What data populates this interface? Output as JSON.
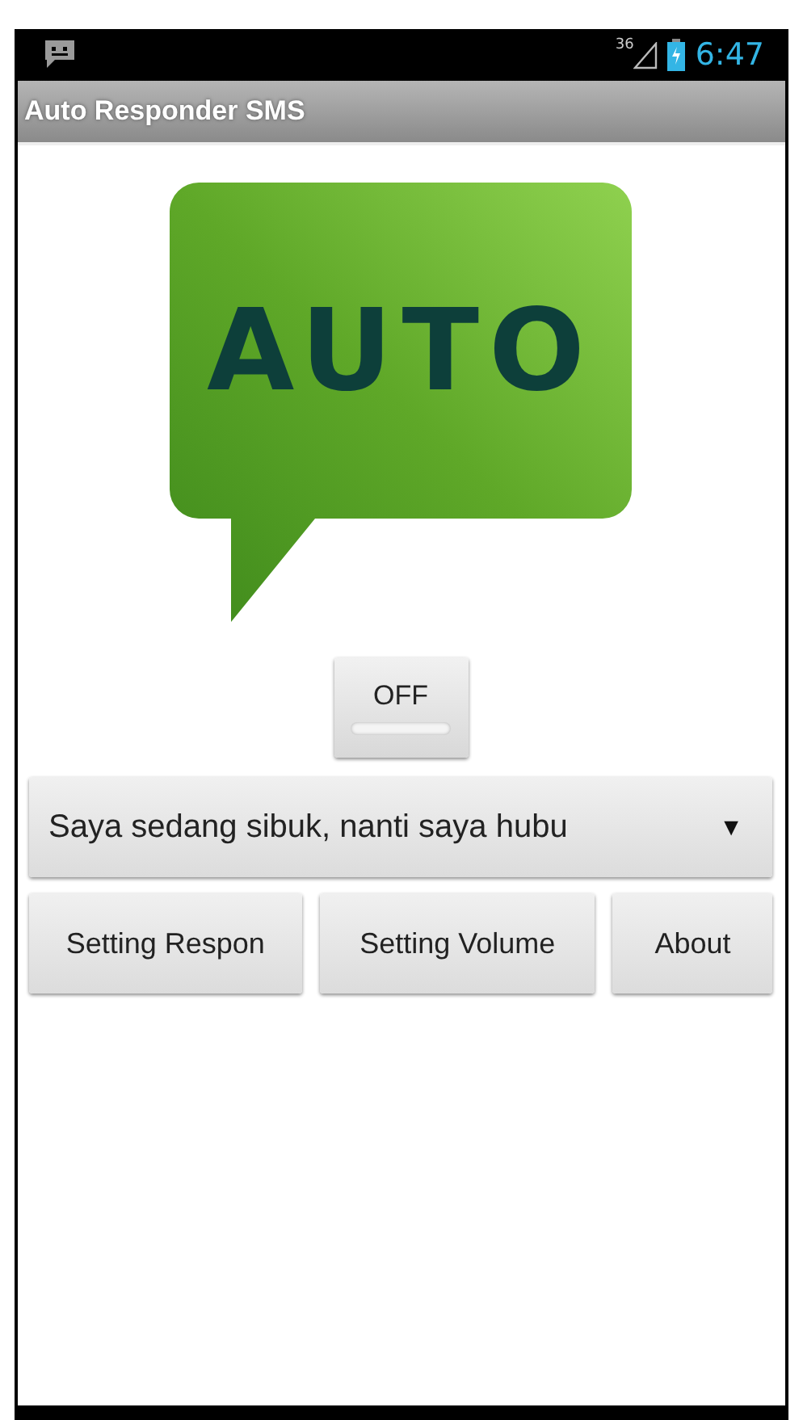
{
  "status_bar": {
    "signal_label": "36",
    "time": "6:47"
  },
  "title_bar": {
    "title": "Auto Responder SMS"
  },
  "logo": {
    "text": "AUTO"
  },
  "toggle": {
    "label": "OFF",
    "on": false
  },
  "spinner": {
    "value": "Saya sedang sibuk, nanti saya hubu",
    "arrow": "▼"
  },
  "buttons": [
    {
      "label": "Setting Respon"
    },
    {
      "label": "Setting Volume"
    },
    {
      "label": "About"
    }
  ]
}
